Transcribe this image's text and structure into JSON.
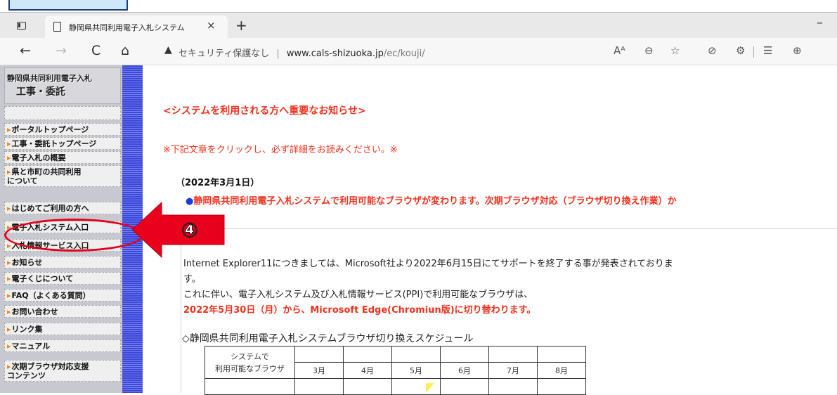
{
  "browser": {
    "tab_title": "静岡県共同利用電子入札システム",
    "tab_close": "×",
    "new_tab": "+",
    "minimize": "–",
    "address_warning": "セキュリティ保護なし",
    "address_separator": "|",
    "address_host": "www.cals-shizuoka.jp",
    "address_path": "/ec/kouji/",
    "nav_back": "←",
    "nav_forward": "→",
    "nav_reload": "C",
    "nav_home": "⌂",
    "tb_read": "Aᴬ",
    "tb_zoom": "⊖",
    "tb_fav": "☆",
    "tb_ext": "⊘",
    "tb_puzzle": "⚙",
    "tb_favorites": "☰",
    "tb_collections": "⊕"
  },
  "sidebar": {
    "brand_line1": "静岡県共同利用電子入札",
    "brand_line2": "工事・委託",
    "items": [
      {
        "label": "ポータルトップページ"
      },
      {
        "label": "工事・委託トップページ"
      },
      {
        "label": "電子入札の概要"
      },
      {
        "label": "県と市町の共同利用\nについて"
      },
      {
        "label": "はじめてご利用の方へ"
      },
      {
        "label": "電子入札システム入口"
      },
      {
        "label": "入札情報サービス入口"
      },
      {
        "label": "お知らせ"
      },
      {
        "label": "電子くじについて"
      },
      {
        "label": "FAQ（よくある質問）"
      },
      {
        "label": "お問い合わせ"
      },
      {
        "label": "リンク集"
      },
      {
        "label": "マニュアル"
      },
      {
        "label": "次期ブラウザ対応支援\nコンテンツ"
      }
    ]
  },
  "annotation": {
    "step": "④",
    "colors": {
      "arrow": "#e8001c",
      "ellipse": "#e4001b"
    }
  },
  "content": {
    "notice_heading": "<システムを利用される方へ重要なお知らせ>",
    "notice_sub": "※下記文章をクリックし、必ず詳細をお読みください。※",
    "date": "（2022年3月1日）",
    "headline_bullet": "●",
    "headline": "静岡県共同利用電子入札システムで利用可能なブラウザが変わります。次期ブラウザ対応（ブラウザ切り換え作業）か",
    "headline_cont": "。",
    "para1_a": "Internet Explorer11につきましては、Microsoft社より2022年6月15日にてサポートを終了する事が発表されておりま",
    "para1_b": "す。",
    "para2": "これに伴い、電子入札システム及び入札情報サービス(PPI)で利用可能なブラウザは、",
    "para3": "2022年5月30日（月）から、Microsoft Edge(Chromiun版)に切り替わります。",
    "schedule_title": "◇静岡県共同利用電子入札システムブラウザ切り換えスケジュール",
    "table": {
      "corner_line1": "システムで",
      "corner_line2": "利用可能なブラウザ",
      "months": [
        "3月",
        "4月",
        "5月",
        "6月",
        "7月",
        "8月"
      ]
    }
  },
  "colors": {
    "accent_red": "#f0301c",
    "sidebar_stripe": "#3a48d8"
  }
}
